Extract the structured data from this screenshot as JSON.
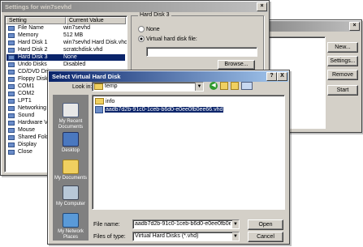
{
  "settings_window": {
    "title": "Settings for win7sevhd",
    "col_setting": "Setting",
    "col_value": "Current Value",
    "rows": [
      {
        "setting": "File Name",
        "value": "win7sevhd",
        "selected": false
      },
      {
        "setting": "Memory",
        "value": "512 MB",
        "selected": false
      },
      {
        "setting": "Hard Disk 1",
        "value": "win7sevhd Hard Disk.vhd",
        "selected": false
      },
      {
        "setting": "Hard Disk 2",
        "value": "scratchdisk.vhd",
        "selected": false
      },
      {
        "setting": "Hard Disk 3",
        "value": "None",
        "selected": true
      },
      {
        "setting": "Undo Disks",
        "value": "Disabled",
        "selected": false
      },
      {
        "setting": "CD/DVD Drive",
        "value": "",
        "selected": false
      },
      {
        "setting": "Floppy Disk",
        "value": "",
        "selected": false
      },
      {
        "setting": "COM1",
        "value": "",
        "selected": false
      },
      {
        "setting": "COM2",
        "value": "",
        "selected": false
      },
      {
        "setting": "LPT1",
        "value": "",
        "selected": false
      },
      {
        "setting": "Networking",
        "value": "",
        "selected": false
      },
      {
        "setting": "Sound",
        "value": "",
        "selected": false
      },
      {
        "setting": "Hardware Virtua",
        "value": "",
        "selected": false
      },
      {
        "setting": "Mouse",
        "value": "",
        "selected": false
      },
      {
        "setting": "Shared Folders",
        "value": "",
        "selected": false
      },
      {
        "setting": "Display",
        "value": "",
        "selected": false
      },
      {
        "setting": "Close",
        "value": "",
        "selected": false
      }
    ],
    "group_label": "Hard Disk 3",
    "radio_none": "None",
    "radio_vhd": "Virtual hard disk file:",
    "browse_label": "Browse..."
  },
  "back_window": {
    "text_fragment_1": "er",
    "text_fragment_2": "unning",
    "btn_new": "New...",
    "btn_settings": "Settings...",
    "btn_remove": "Remove",
    "btn_start": "Start"
  },
  "dialog": {
    "title": "Select Virtual Hard Disk",
    "help_btn": "?",
    "close_btn": "X",
    "lookin_label": "Look in:",
    "lookin_value": "temp",
    "places": [
      {
        "label": "My Recent Documents",
        "icon": "recent-documents-icon"
      },
      {
        "label": "Desktop",
        "icon": "desktop-icon"
      },
      {
        "label": "My Documents",
        "icon": "my-documents-icon"
      },
      {
        "label": "My Computer",
        "icon": "my-computer-icon"
      },
      {
        "label": "My Network Places",
        "icon": "network-places-icon"
      }
    ],
    "files": [
      {
        "name": "info",
        "type": "folder",
        "selected": false
      },
      {
        "name": "aadb7d2b-91c0-1ceb-b6d0-e0ee0fb0ee66.vhd",
        "type": "vhd",
        "selected": true
      }
    ],
    "filename_label": "File name:",
    "filename_value": "aadb7d2b-91c0-1ceb-b6d0-e0ee0fb0ee66.vhd",
    "filetype_label": "Files of type:",
    "filetype_value": "Virtual Hard Disks (*.vhd)",
    "open_label": "Open",
    "cancel_label": "Cancel"
  },
  "colors": {
    "active_title": "#0a246a",
    "selection": "#0a246a",
    "face": "#d4d0c8"
  }
}
